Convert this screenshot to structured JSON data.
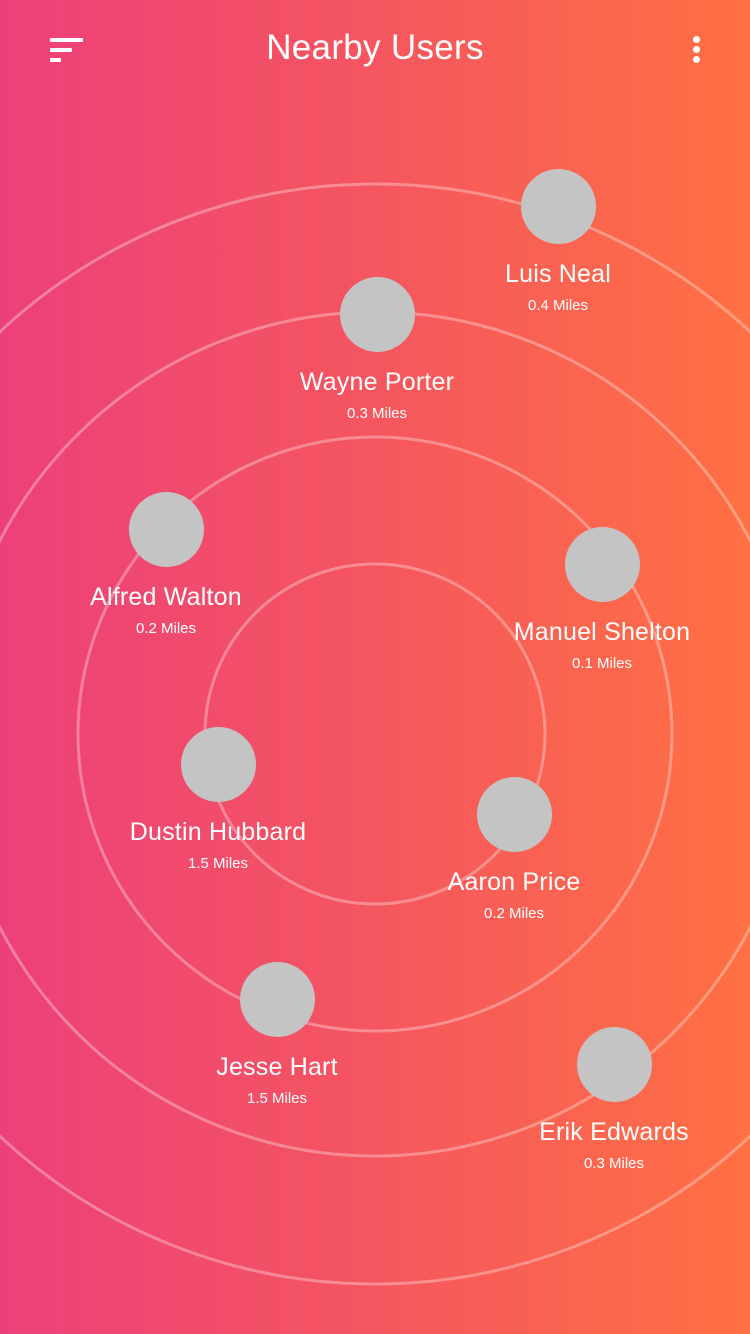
{
  "header": {
    "title": "Nearby Users"
  },
  "users": [
    {
      "name": "Luis Neal",
      "distance": "0.4 Miles"
    },
    {
      "name": "Wayne Porter",
      "distance": "0.3 Miles"
    },
    {
      "name": "Alfred Walton",
      "distance": "0.2 Miles"
    },
    {
      "name": "Manuel Shelton",
      "distance": "0.1 Miles"
    },
    {
      "name": "Dustin Hubbard",
      "distance": "1.5 Miles"
    },
    {
      "name": "Aaron Price",
      "distance": "0.2 Miles"
    },
    {
      "name": "Jesse Hart",
      "distance": "1.5 Miles"
    },
    {
      "name": "Erik Edwards",
      "distance": "0.3 Miles"
    }
  ],
  "icons": {
    "menu": "menu-icon",
    "more": "more-vertical-icon"
  },
  "colors": {
    "gradient_start": "#ec407a",
    "gradient_end": "#ff7043",
    "avatar_placeholder": "#c4c4c4"
  }
}
